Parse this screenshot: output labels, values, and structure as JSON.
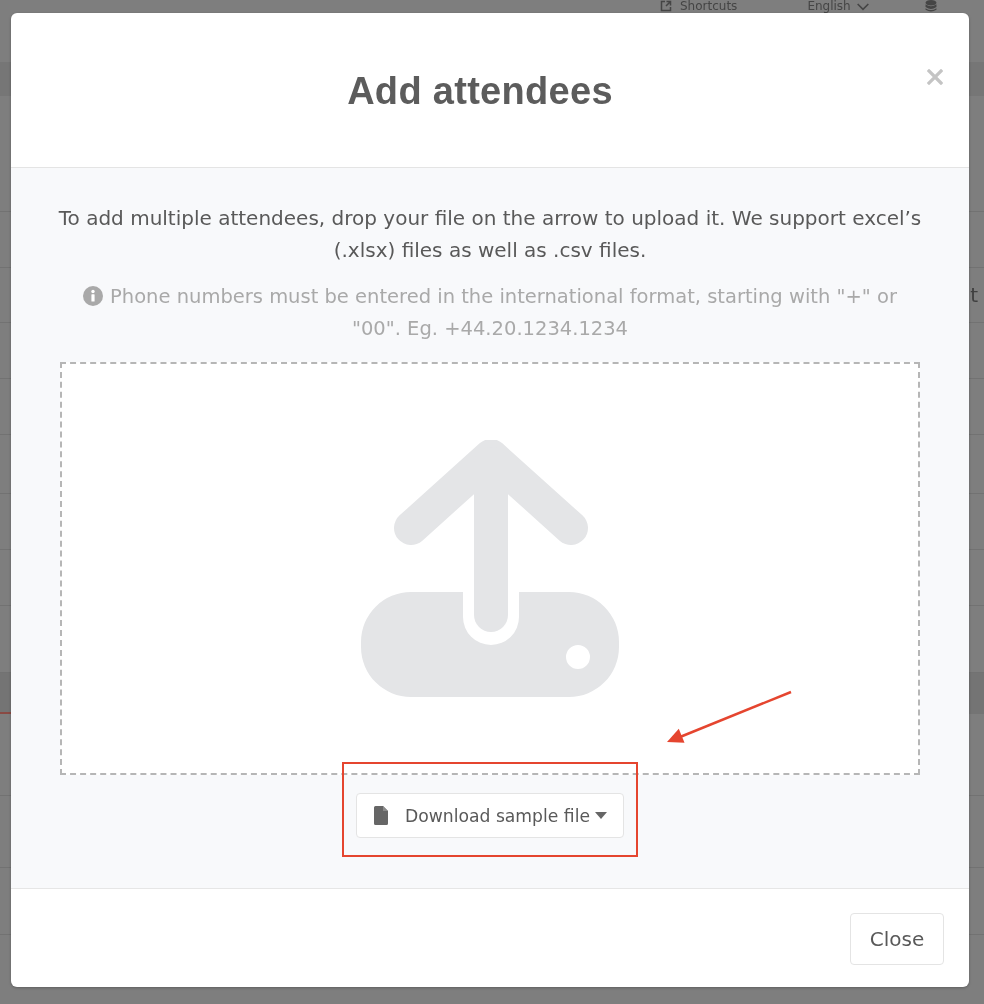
{
  "background_page": {
    "header": {
      "shortcuts_label": "Shortcuts",
      "language": "English"
    },
    "row_text": "t"
  },
  "dialog": {
    "title": "Add attendees",
    "instructions": "To add multiple attendees, drop your file on the arrow to upload it. We support excel’s (.xlsx) files as well as .csv files.",
    "phone_note": "Phone numbers must be entered in the international format, starting with \"+\" or \"00\". Eg. +44.20.1234.1234",
    "download_button": "Download sample file",
    "close_button": "Close"
  }
}
